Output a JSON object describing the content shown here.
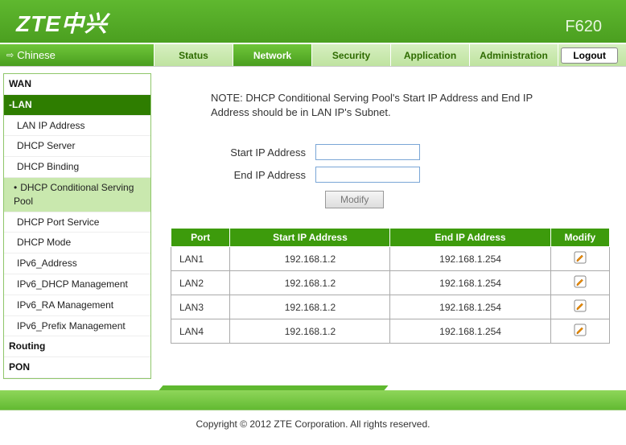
{
  "header": {
    "brand": "ZTE中兴",
    "model": "F620"
  },
  "lang_switch": "Chinese",
  "tabs": [
    "Status",
    "Network",
    "Security",
    "Application",
    "Administration"
  ],
  "active_tab_index": 1,
  "logout_label": "Logout",
  "sidebar": {
    "items": [
      {
        "label": "WAN",
        "type": "top"
      },
      {
        "label": "-LAN",
        "type": "section-active"
      },
      {
        "label": "LAN IP Address",
        "type": "sub"
      },
      {
        "label": "DHCP Server",
        "type": "sub"
      },
      {
        "label": "DHCP Binding",
        "type": "sub"
      },
      {
        "label": "DHCP Conditional Serving Pool",
        "type": "sub-active"
      },
      {
        "label": "DHCP Port Service",
        "type": "sub"
      },
      {
        "label": "DHCP Mode",
        "type": "sub"
      },
      {
        "label": "IPv6_Address",
        "type": "sub"
      },
      {
        "label": "IPv6_DHCP Management",
        "type": "sub"
      },
      {
        "label": "IPv6_RA Management",
        "type": "sub"
      },
      {
        "label": "IPv6_Prefix Management",
        "type": "sub"
      },
      {
        "label": "Routing",
        "type": "top"
      },
      {
        "label": "PON",
        "type": "top"
      }
    ]
  },
  "content": {
    "note": "NOTE:  DHCP Conditional Serving Pool's Start IP Address and End IP Address should be in LAN IP's Subnet.",
    "form": {
      "start_label": "Start IP Address",
      "end_label": "End IP Address",
      "start_value": "",
      "end_value": "",
      "modify_label": "Modify"
    },
    "table": {
      "headers": [
        "Port",
        "Start IP Address",
        "End IP Address",
        "Modify"
      ],
      "rows": [
        {
          "port": "LAN1",
          "start": "192.168.1.2",
          "end": "192.168.1.254"
        },
        {
          "port": "LAN2",
          "start": "192.168.1.2",
          "end": "192.168.1.254"
        },
        {
          "port": "LAN3",
          "start": "192.168.1.2",
          "end": "192.168.1.254"
        },
        {
          "port": "LAN4",
          "start": "192.168.1.2",
          "end": "192.168.1.254"
        }
      ]
    }
  },
  "footer": "Copyright © 2012 ZTE Corporation. All rights reserved."
}
